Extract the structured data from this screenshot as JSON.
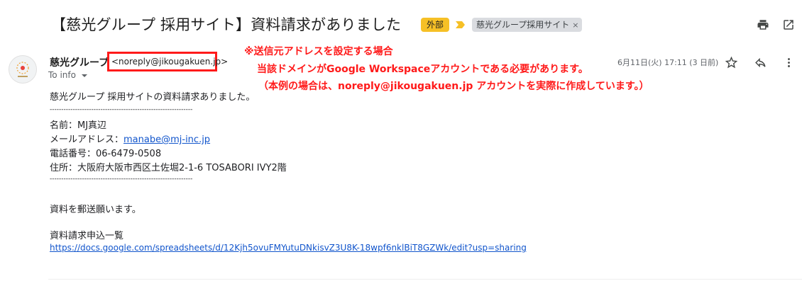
{
  "email": {
    "subject": "【慈光グループ 採用サイト】資料請求がありました",
    "label_external": "外部",
    "label_tag": "慈光グループ採用サイト",
    "label_tag_close": "×",
    "sender_name": "慈光グループ",
    "sender_email": "<noreply@jikougakuen.jp>",
    "to_label": "To info",
    "date": "6月11日(火) 17:11 (3 日前)",
    "body": {
      "intro": "慈光グループ 採用サイトの資料請求ありました。",
      "separator": "--------------------------------------------------------------",
      "name": "名前：MJ真辺",
      "email_label": "メールアドレス：",
      "email_link": "manabe@mj-inc.jp",
      "phone": "電話番号：06-6479-0508",
      "address": "住所：大阪府大阪市西区土佐堀2-1-6 TOSABORI IVY2階",
      "request": "資料を郵送願います。",
      "list_label": "資料請求申込一覧",
      "list_link": "https://docs.google.com/spreadsheets/d/12Kjh5ovuFMYutuDNkisvZ3U8K-18wpf6nklBiT8GZWk/edit?usp=sharing"
    }
  },
  "annotation": {
    "line1": "※送信元アドレスを設定する場合",
    "line2": "当該ドメインがGoogle Workspaceアカウントである必要があります。",
    "line3": "（本例の場合は、noreply@jikougakuen.jp アカウントを実際に作成しています。）",
    "color": "#ff1a1a"
  },
  "icons": {
    "print": "print-icon",
    "open_new_window": "open-in-new-window-icon",
    "star": "star-icon",
    "reply": "reply-icon",
    "more": "more-vertical-icon",
    "importance": "importance-marker-icon",
    "dropdown": "chevron-down-icon"
  },
  "colors": {
    "external_chip": "#f6c026",
    "tag_chip": "#dadce0",
    "link": "#1155cc"
  }
}
